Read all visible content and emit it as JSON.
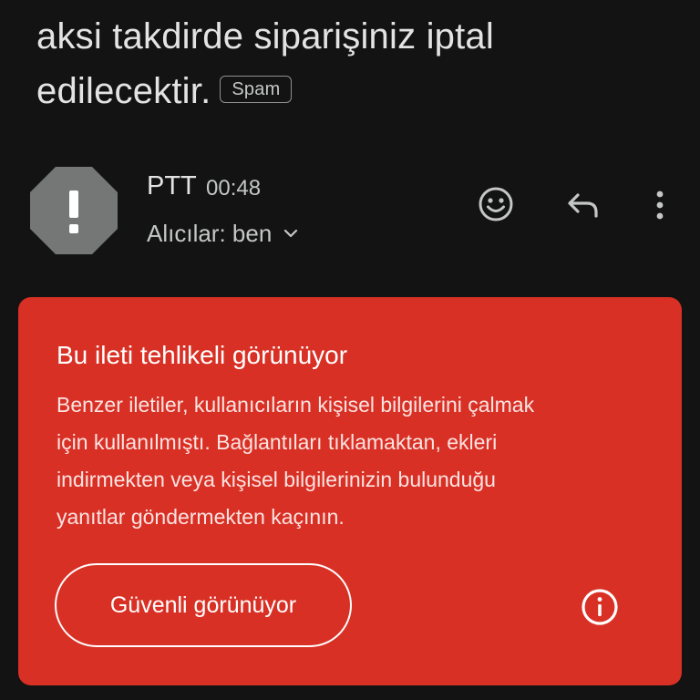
{
  "subject": {
    "line1": "aksi takdirde siparişiniz iptal",
    "line2": "edilecektir.",
    "badge": "Spam"
  },
  "sender": {
    "avatar_icon": "exclamation-octagon-icon",
    "name": "PTT",
    "time": "00:48",
    "recipients": "Alıcılar: ben",
    "expand_icon": "chevron-down-icon"
  },
  "actions": {
    "emoji_icon": "smiley-icon",
    "reply_icon": "reply-icon",
    "more_icon": "more-vert-icon"
  },
  "warning": {
    "title": "Bu ileti tehlikeli görünüyor",
    "body_lines": [
      "Benzer iletiler, kullanıcıların kişisel bilgilerini çalmak",
      "için kullanılmıştı. Bağlantıları tıklamaktan, ekleri",
      "indirmekten veya kişisel bilgilerinizin bulunduğu",
      "yanıtlar göndermekten kaçının."
    ],
    "safe_button": "Güvenli görünüyor",
    "info_icon": "info-icon"
  },
  "colors": {
    "background": "#131314",
    "warning_red": "#d93025",
    "avatar_gray": "#747775",
    "text_primary": "#e3e3e3",
    "text_secondary": "#c4c7c5"
  }
}
